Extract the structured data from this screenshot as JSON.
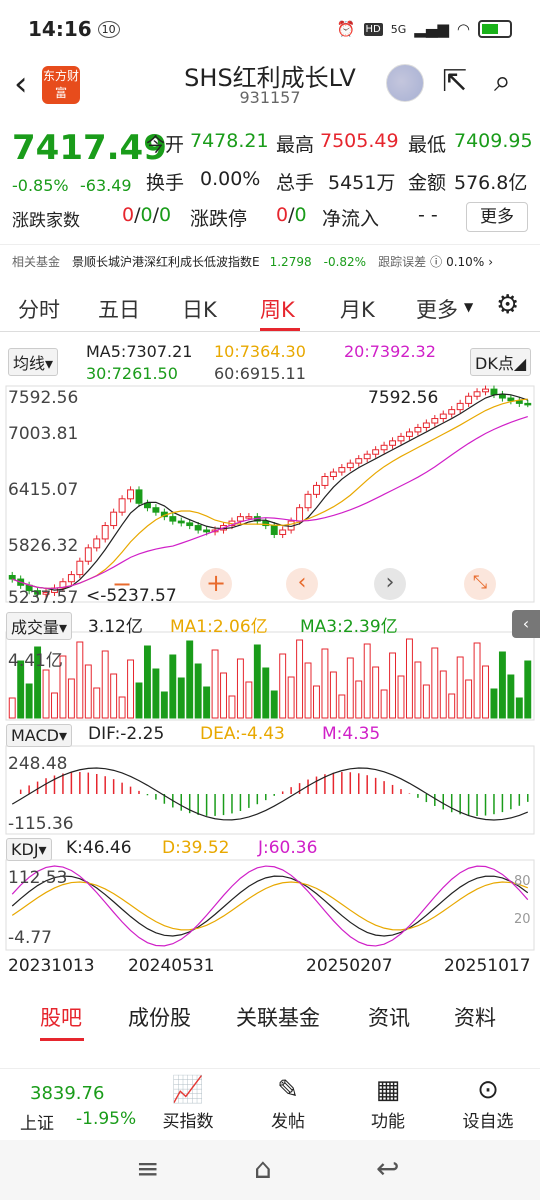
{
  "status": {
    "time": "14:16",
    "badge": "10",
    "icons": [
      "alarm-icon",
      "hd-icon",
      "signal-5g-icon",
      "wifi-icon",
      "battery-icon"
    ],
    "net": "5G"
  },
  "header": {
    "title": "SHS红利成长LV",
    "code": "931157",
    "logo_text": "东方财富"
  },
  "quote": {
    "price": "7417.49",
    "change_pct": "-0.85%",
    "change": "-63.49",
    "open_label": "今开",
    "open": "7478.21",
    "high_label": "最高",
    "high": "7505.49",
    "low_label": "最低",
    "low": "7409.95",
    "turnover_label": "换手",
    "turnover": "0.00%",
    "volume_label": "总手",
    "volume": "5451万",
    "amount_label": "金额",
    "amount": "576.8亿",
    "adv_label": "涨跌家数",
    "adv": [
      "0",
      "0",
      "0"
    ],
    "limit_label": "涨跌停",
    "limit": [
      "0",
      "0"
    ],
    "inflow_label": "净流入",
    "inflow": "- -",
    "more": "更多"
  },
  "fund": {
    "label": "相关基金",
    "name": "景顺长城沪港深红利成长低波指数E",
    "nav": "1.2798",
    "chg": "-0.82%",
    "te_label": "跟踪误差",
    "te": "0.10%"
  },
  "tabs": [
    "分时",
    "五日",
    "日K",
    "周K",
    "月K",
    "更多"
  ],
  "ma": {
    "selector": "均线",
    "ma5": "MA5:7307.21",
    "ma10": "10:7364.30",
    "ma20": "20:7392.32",
    "ma30": "30:7261.50",
    "ma60": "60:6915.11",
    "dk": "DK点"
  },
  "indicators": {
    "vol_label": "成交量",
    "vol": "3.12亿",
    "vol_ma1": "MA1:2.06亿",
    "vol_ma3": "MA3:2.39亿",
    "vol_max": "4.41亿",
    "macd_label": "MACD",
    "dif": "DIF:-2.25",
    "dea": "DEA:-4.43",
    "m": "M:4.35",
    "macd_max": "248.48",
    "macd_min": "-115.36",
    "kdj_label": "KDJ",
    "k": "K:46.46",
    "d": "D:39.52",
    "j": "J:60.36",
    "kdj_max": "112.53",
    "kdj_min": "-4.77",
    "kdj_80": "80",
    "kdj_20": "20"
  },
  "bottom_tabs": [
    "股吧",
    "成份股",
    "关联基金",
    "资讯",
    "资料"
  ],
  "footer": {
    "index_value": "3839.76",
    "index_name": "上证",
    "index_chg": "-1.95%",
    "items": [
      {
        "label": "买指数",
        "icon": "chart-icon"
      },
      {
        "label": "发帖",
        "icon": "edit-icon"
      },
      {
        "label": "功能",
        "icon": "grid-icon"
      },
      {
        "label": "设自选",
        "icon": "more-dots-icon"
      }
    ]
  },
  "chart_data": {
    "type": "candlestick",
    "title": "SHS红利成长LV 周K",
    "y_ticks": [
      "7592.56",
      "7003.81",
      "6415.07",
      "5826.32",
      "5237.57"
    ],
    "ylim": [
      5237.57,
      7592.56
    ],
    "max_label": "7592.56",
    "min_label": "5237.57",
    "x_ticks": [
      "20231013",
      "20240531",
      "20250207",
      "20251017"
    ],
    "close_approx": [
      5450,
      5380,
      5320,
      5280,
      5300,
      5350,
      5420,
      5500,
      5650,
      5800,
      5900,
      6050,
      6200,
      6350,
      6450,
      6300,
      6250,
      6200,
      6150,
      6100,
      6080,
      6050,
      6000,
      5980,
      6000,
      6050,
      6100,
      6150,
      6150,
      6100,
      6050,
      5950,
      6000,
      6100,
      6250,
      6400,
      6500,
      6600,
      6650,
      6700,
      6750,
      6800,
      6850,
      6900,
      6950,
      7000,
      7050,
      7100,
      7150,
      7200,
      7250,
      7300,
      7350,
      7420,
      7500,
      7550,
      7580,
      7520,
      7480,
      7450,
      7420,
      7417.49
    ]
  }
}
